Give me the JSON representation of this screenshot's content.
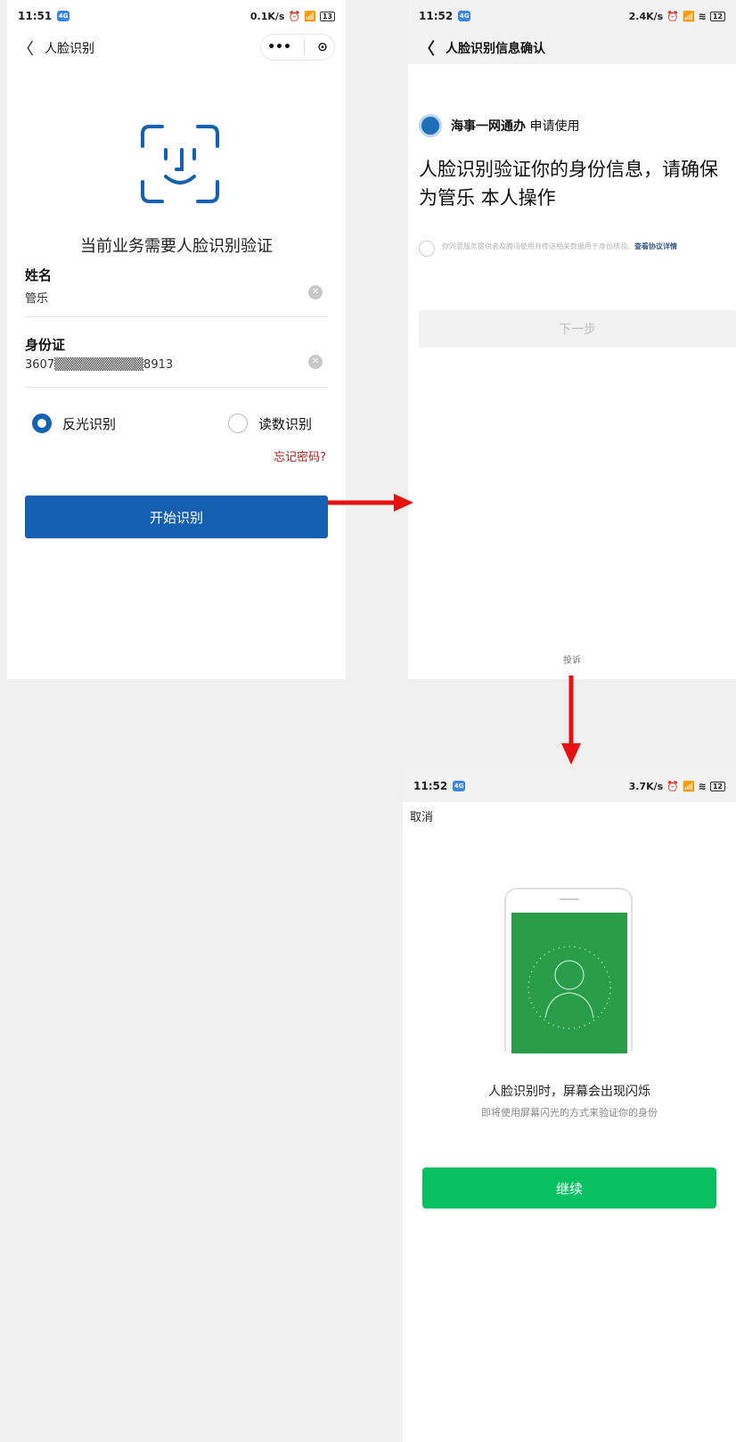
{
  "panel1": {
    "status": {
      "time": "11:51",
      "badge": "4G",
      "net": "0.1K/s",
      "battery": "13"
    },
    "nav": {
      "back": "〈",
      "title": "人脸识别",
      "more": "•••",
      "target": "⊙"
    },
    "lead": "当前业务需要人脸识别验证",
    "name": {
      "label": "姓名",
      "value": "管乐"
    },
    "id": {
      "label": "身份证",
      "value": "3607▒▒▒▒▒▒▒▒▒▒8913"
    },
    "options": [
      {
        "label": "反光识别",
        "selected": true
      },
      {
        "label": "读数识别",
        "selected": false
      }
    ],
    "forgot": "忘记密码?",
    "start_button": "开始识别"
  },
  "panel2": {
    "status": {
      "time": "11:52",
      "badge": "4G",
      "net": "2.4K/s",
      "battery": "12"
    },
    "nav": {
      "back": "〈",
      "title": "人脸识别信息确认"
    },
    "applicant_name": "海事一网通办",
    "applicant_suffix": "申请使用",
    "title": "人脸识别验证你的身份信息，请确保为管乐 本人操作",
    "agree_text": "你同意服务提供者及腾讯使用并传送相关数据用于身份核验。",
    "agree_link": "查看协议详情",
    "next_button": "下一步",
    "complain": "投诉"
  },
  "panel3": {
    "status": {
      "time": "11:52",
      "badge": "4G",
      "net": "3.7K/s",
      "battery": "12"
    },
    "cancel": "取消",
    "flash_title": "人脸识别时，屏幕会出现闪烁",
    "flash_sub": "即将使用屏幕闪光的方式来验证你的身份",
    "continue_button": "继续"
  },
  "colors": {
    "primary_blue": "#1660b2",
    "wechat_green": "#07c160",
    "arrow_red": "#e81010"
  }
}
